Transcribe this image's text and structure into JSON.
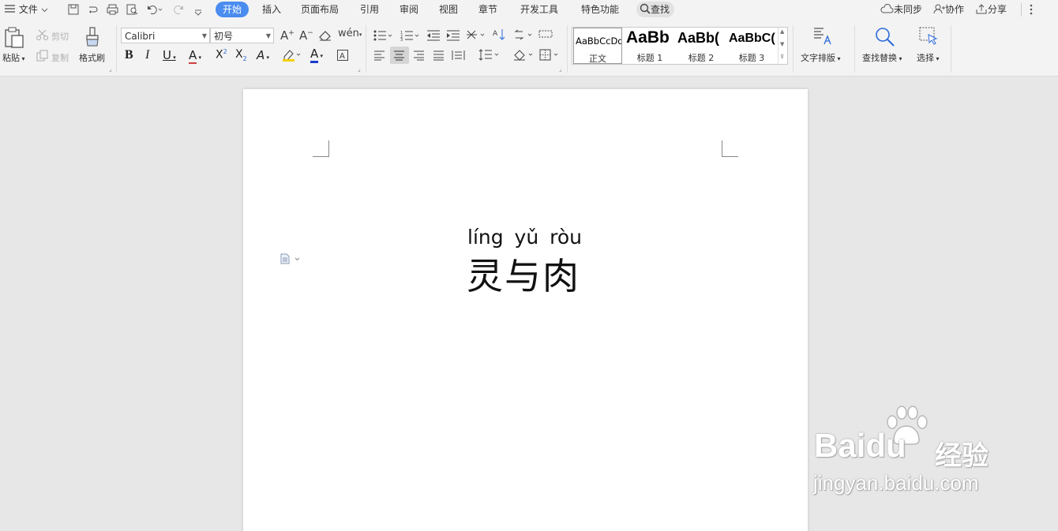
{
  "menubar": {
    "file_label": "文件",
    "tabs": [
      "开始",
      "插入",
      "页面布局",
      "引用",
      "审阅",
      "视图",
      "章节",
      "开发工具",
      "特色功能"
    ],
    "search_label": "查找",
    "sync_label": "未同步",
    "collab_label": "协作",
    "share_label": "分享"
  },
  "ribbon": {
    "paste_label": "粘贴",
    "cut_label": "剪切",
    "copy_label": "复制",
    "format_painter_label": "格式刷",
    "font_name": "Calibri",
    "font_size": "初号",
    "styles": [
      {
        "sample": "AaBbCcDd",
        "name": "正文"
      },
      {
        "sample": "AaBb",
        "name": "标题 1"
      },
      {
        "sample": "AaBb(",
        "name": "标题 2"
      },
      {
        "sample": "AaBbC(",
        "name": "标题 3"
      }
    ],
    "text_layout_label": "文字排版",
    "find_replace_label": "查找替换",
    "select_label": "选择"
  },
  "document": {
    "pinyin": "líng yǔ ròu",
    "title": "灵与肉"
  },
  "watermark": {
    "brand": "Bai",
    "brand_suffix": "du",
    "product": "经验",
    "url": "jingyan.baidu.com"
  },
  "colors": {
    "accent": "#4a8cf0",
    "highlight": "#f5d000",
    "font_color": "#1a3ccc",
    "underline_a": "#d04040"
  }
}
